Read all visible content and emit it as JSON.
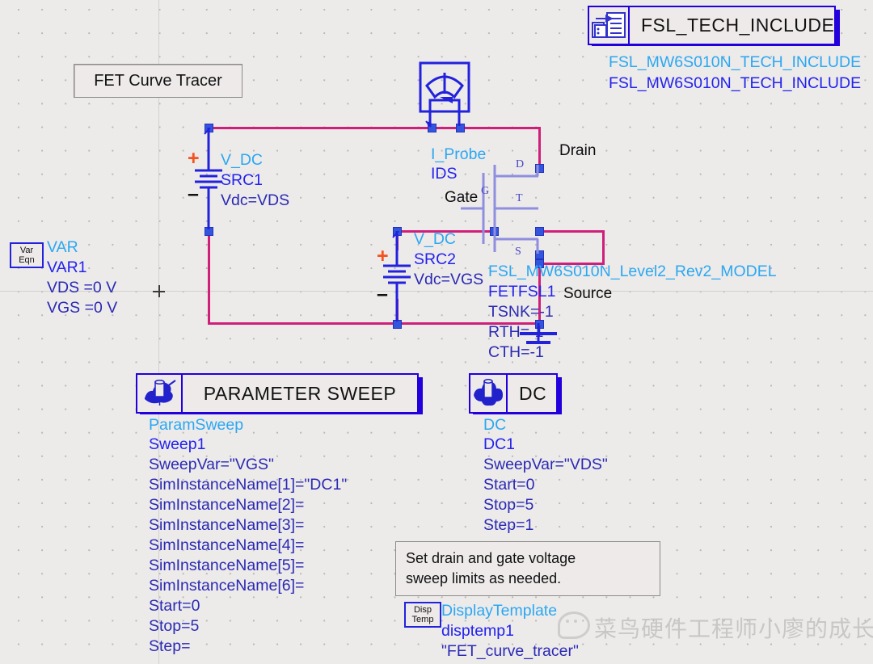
{
  "canvas": {
    "title_box": "FET Curve Tracer",
    "note_box": "Set drain and gate voltage\nsweep limits as needed.",
    "watermark": "菜鸟硬件工程师小廖的成长日记"
  },
  "tech_include": {
    "block_title": "FSL_TECH_INCLUDE",
    "icon": "include-file-icon",
    "line1": "FSL_MW6S010N_TECH_INCLUDE",
    "line2": "FSL_MW6S010N_TECH_INCLUDE"
  },
  "var_eqn": {
    "icon_line1": "Var",
    "icon_line2": "Eqn",
    "type": "VAR",
    "name": "VAR1",
    "params": [
      "VDS =0 V",
      "VGS =0 V"
    ]
  },
  "src1": {
    "type": "V_DC",
    "name": "SRC1",
    "param": "Vdc=VDS",
    "plus": "+",
    "minus": "–"
  },
  "src2": {
    "type": "V_DC",
    "name": "SRC2",
    "param": "Vdc=VGS",
    "plus": "+",
    "minus": "–"
  },
  "iprobe": {
    "type": "I_Probe",
    "name": "IDS",
    "icon": "ammeter-icon"
  },
  "fet": {
    "model": "FSL_MW6S010N_Level2_Rev2_MODEL",
    "name": "FETFSL1",
    "params": [
      "TSNK=-1",
      "RTH=-1",
      "CTH=-1"
    ],
    "pins": {
      "drain": "D",
      "gate": "G",
      "thermal": "T",
      "source": "S"
    },
    "terminals": {
      "drain": "Drain",
      "gate": "Gate",
      "source": "Source"
    }
  },
  "param_sweep": {
    "block_title": "PARAMETER SWEEP",
    "icon": "param-sweep-icon",
    "type": "ParamSweep",
    "name": "Sweep1",
    "params": [
      "SweepVar=\"VGS\"",
      "SimInstanceName[1]=\"DC1\"",
      "SimInstanceName[2]=",
      "SimInstanceName[3]=",
      "SimInstanceName[4]=",
      "SimInstanceName[5]=",
      "SimInstanceName[6]=",
      "Start=0",
      "Stop=5",
      "Step="
    ]
  },
  "dc_sim": {
    "block_title": "DC",
    "icon": "dc-sim-icon",
    "type": "DC",
    "name": "DC1",
    "params": [
      "SweepVar=\"VDS\"",
      "Start=0",
      "Stop=5",
      "Step=1"
    ]
  },
  "display_template": {
    "icon_line1": "Disp",
    "icon_line2": "Temp",
    "type": "DisplayTemplate",
    "name": "disptemp1",
    "value": "\"FET_curve_tracer\""
  },
  "colors": {
    "wire": "#cf1f7a",
    "component": "#2222ee",
    "type_label": "#2aa8f2",
    "background": "#edeaea"
  }
}
